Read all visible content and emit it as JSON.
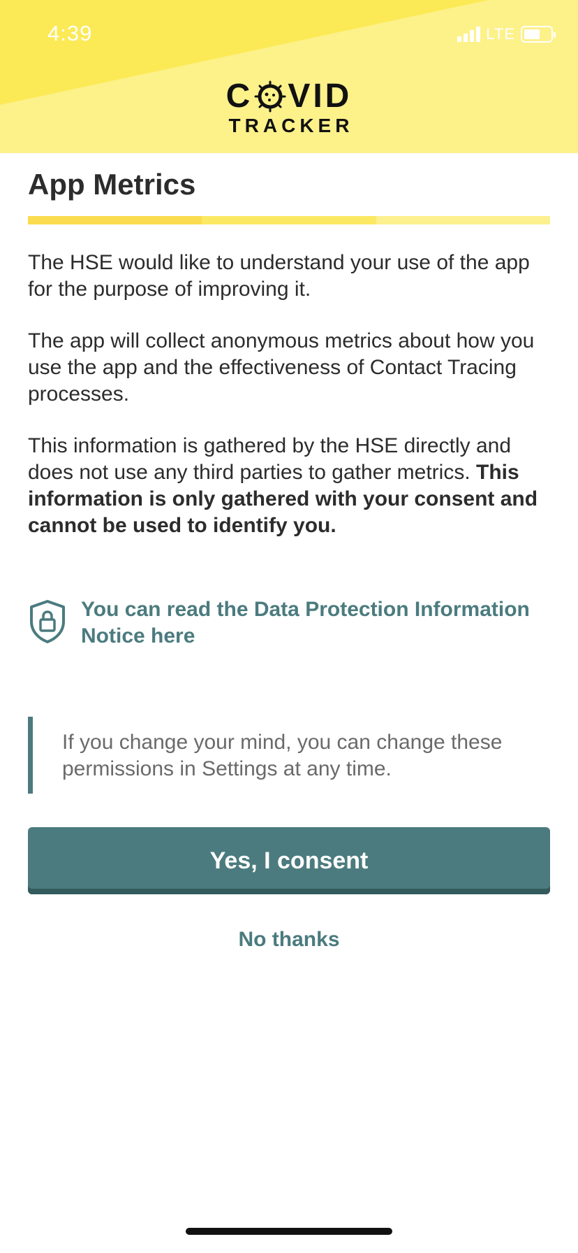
{
  "status_bar": {
    "time": "4:39",
    "network": "LTE"
  },
  "logo": {
    "line1_left": "C",
    "line1_right": "VID",
    "line2": "TRACKER"
  },
  "page": {
    "title": "App Metrics",
    "progress_segment_colors": [
      "#fbdc4e",
      "#fbe963",
      "#fdf08f"
    ]
  },
  "body": {
    "para1": "The HSE would like to understand your use of the app for the purpose of improving it.",
    "para2": "The app will collect anonymous metrics about how you use the app and the effectiveness of Contact Tracing processes.",
    "para3_regular": "This information is gathered by the HSE directly and does not use any third parties to gather metrics. ",
    "para3_bold": "This information is only gathered with your consent and cannot be used to identify you."
  },
  "data_protection": {
    "icon": "shield-lock-icon",
    "link_text": "You can read the Data Protection Information Notice here"
  },
  "notice": {
    "text": "If you change your mind, you can change these permissions in Settings at any time."
  },
  "actions": {
    "consent_label": "Yes, I consent",
    "decline_label": "No thanks"
  },
  "colors": {
    "header_yellow": "#fdf18a",
    "header_band": "#fbea55",
    "accent_teal": "#4b7b7e"
  }
}
